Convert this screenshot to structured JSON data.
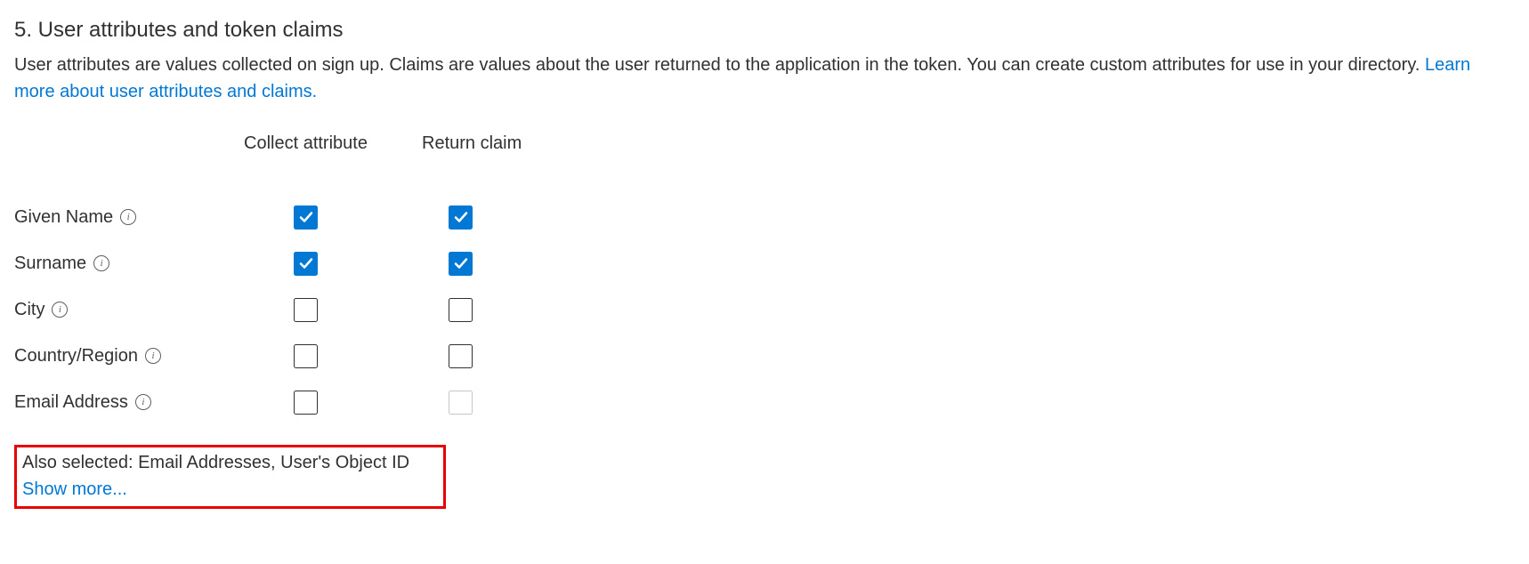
{
  "section": {
    "title": "5. User attributes and token claims",
    "description_prefix": "User attributes are values collected on sign up. Claims are values about the user returned to the application in the token. You can create custom attributes for use in your directory. ",
    "learn_more_label": "Learn more about user attributes and claims."
  },
  "columns": {
    "collect": "Collect attribute",
    "return": "Return claim"
  },
  "attributes": [
    {
      "label": "Given Name",
      "collect_checked": true,
      "return_checked": true,
      "return_disabled": false
    },
    {
      "label": "Surname",
      "collect_checked": true,
      "return_checked": true,
      "return_disabled": false
    },
    {
      "label": "City",
      "collect_checked": false,
      "return_checked": false,
      "return_disabled": false
    },
    {
      "label": "Country/Region",
      "collect_checked": false,
      "return_checked": false,
      "return_disabled": false
    },
    {
      "label": "Email Address",
      "collect_checked": false,
      "return_checked": false,
      "return_disabled": true
    }
  ],
  "footer": {
    "also_selected": "Also selected: Email Addresses, User's Object ID",
    "show_more": "Show more..."
  },
  "info_glyph": "i"
}
